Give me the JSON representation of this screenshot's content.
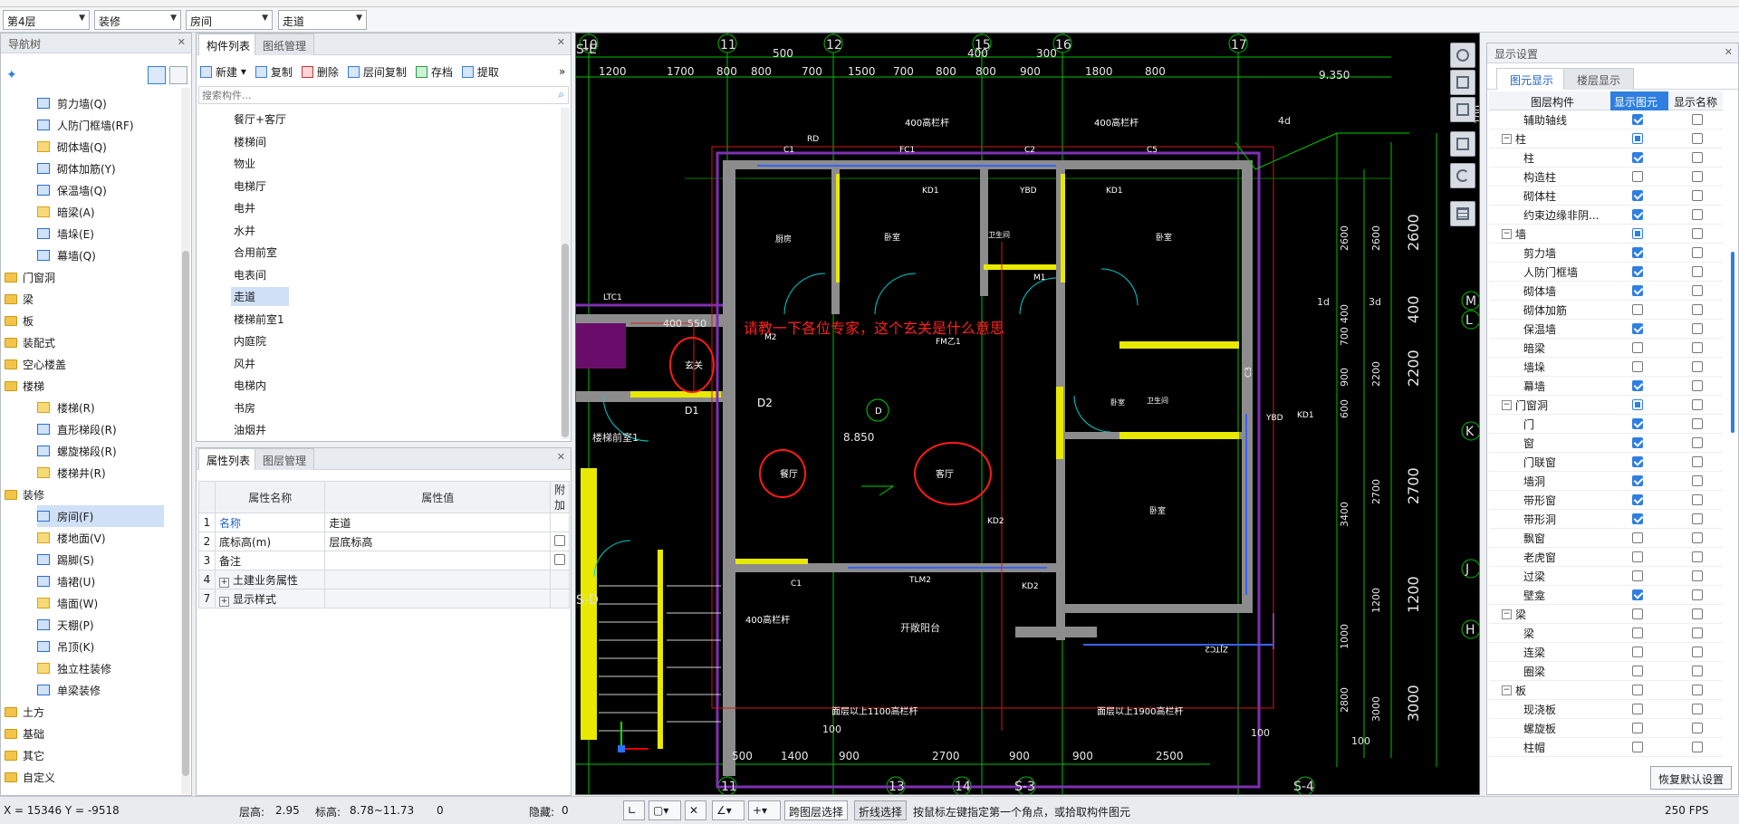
{
  "topbar": {
    "floor": "第4层",
    "category": "装修",
    "component": "房间",
    "sub": "走道"
  },
  "nav": {
    "title": "导航树",
    "items": [
      {
        "label": "剪力墙(Q)",
        "indent": 2
      },
      {
        "label": "人防门框墙(RF)",
        "indent": 2
      },
      {
        "label": "砌体墙(Q)",
        "indent": 2
      },
      {
        "label": "砌体加筋(Y)",
        "indent": 2
      },
      {
        "label": "保温墙(Q)",
        "indent": 2
      },
      {
        "label": "暗梁(A)",
        "indent": 2
      },
      {
        "label": "墙垛(E)",
        "indent": 2
      },
      {
        "label": "幕墙(Q)",
        "indent": 2
      },
      {
        "label": "门窗洞",
        "indent": 0
      },
      {
        "label": "梁",
        "indent": 0
      },
      {
        "label": "板",
        "indent": 0
      },
      {
        "label": "装配式",
        "indent": 0
      },
      {
        "label": "空心楼盖",
        "indent": 0
      },
      {
        "label": "楼梯",
        "indent": 0
      },
      {
        "label": "楼梯(R)",
        "indent": 2
      },
      {
        "label": "直形梯段(R)",
        "indent": 2
      },
      {
        "label": "螺旋梯段(R)",
        "indent": 2
      },
      {
        "label": "楼梯井(R)",
        "indent": 2
      },
      {
        "label": "装修",
        "indent": 0
      },
      {
        "label": "房间(F)",
        "indent": 2,
        "selected": true
      },
      {
        "label": "楼地面(V)",
        "indent": 2
      },
      {
        "label": "踢脚(S)",
        "indent": 2
      },
      {
        "label": "墙裙(U)",
        "indent": 2
      },
      {
        "label": "墙面(W)",
        "indent": 2
      },
      {
        "label": "天棚(P)",
        "indent": 2
      },
      {
        "label": "吊顶(K)",
        "indent": 2
      },
      {
        "label": "独立柱装修",
        "indent": 2
      },
      {
        "label": "单梁装修",
        "indent": 2
      },
      {
        "label": "土方",
        "indent": 0
      },
      {
        "label": "基础",
        "indent": 0
      },
      {
        "label": "其它",
        "indent": 0
      },
      {
        "label": "自定义",
        "indent": 0
      }
    ]
  },
  "complist": {
    "tabs": [
      "构件列表",
      "图纸管理"
    ],
    "toolbar": [
      "新建",
      "复制",
      "删除",
      "层间复制",
      "存档",
      "提取"
    ],
    "search_placeholder": "搜索构件...",
    "items": [
      "餐厅+客厅",
      "楼梯间",
      "物业",
      "电梯厅",
      "电井",
      "水井",
      "合用前室",
      "电表间",
      "走道",
      "楼梯前室1",
      "内庭院",
      "风井",
      "电梯内",
      "书房",
      "油烟井"
    ],
    "selected": "走道"
  },
  "props": {
    "tabs": [
      "属性列表",
      "图层管理"
    ],
    "headers": [
      "",
      "属性名称",
      "属性值",
      "附加"
    ],
    "rows": [
      {
        "num": "1",
        "name": "名称",
        "value": "走道",
        "extra": ""
      },
      {
        "num": "2",
        "name": "底标高(m)",
        "value": "层底标高",
        "extra": "cb"
      },
      {
        "num": "3",
        "name": "备注",
        "value": "",
        "extra": "cb"
      },
      {
        "num": "4",
        "name": "土建业务属性",
        "value": "",
        "extra": "",
        "expand": true
      },
      {
        "num": "7",
        "name": "显示样式",
        "value": "",
        "extra": "",
        "expand": true
      }
    ]
  },
  "cad": {
    "top_axes": [
      "10",
      "11",
      "12",
      "15",
      "16",
      "17"
    ],
    "top_dims": [
      "1200",
      "1700",
      "800",
      "800",
      "700",
      "1500",
      "700",
      "800",
      "800",
      "900",
      "1800",
      "800"
    ],
    "top_dims2": [
      "500",
      "400",
      "300"
    ],
    "bottom_dims": [
      "500",
      "1400",
      "900",
      "2700",
      "900",
      "900",
      "2500"
    ],
    "bottom_axes": [
      "11",
      "13",
      "14",
      "S-3",
      "S-4"
    ],
    "right_axes": [
      "M",
      "L",
      "K",
      "J",
      "H"
    ],
    "right_dims": [
      "2600",
      "400",
      "2200",
      "2700",
      "1200",
      "3000"
    ],
    "right_dims_small": [
      "2600",
      "2600",
      "400",
      "700",
      "900",
      "600",
      "2200",
      "3400",
      "2700",
      "1200",
      "2800",
      "3000",
      "100",
      "1000"
    ],
    "left_axes": [
      "S-E",
      "S-D"
    ],
    "elev": "9.350",
    "elev2": "8.850",
    "annotation": "请教一下各位专家，这个玄关是什么意思",
    "room_labels": [
      "玄关",
      "餐厅",
      "客厅",
      "厨房",
      "卧室",
      "卧室",
      "卫生间",
      "卧室",
      "卫生间",
      "卧室",
      "D1",
      "D2",
      "D",
      "M1",
      "M2",
      "KD1",
      "KD1",
      "KD1",
      "YBD",
      "YBD",
      "FC1",
      "C1",
      "C2",
      "C5",
      "C1",
      "RD",
      "LTC1",
      "TLM2",
      "KD2",
      "KD2",
      "FM乙1",
      "FM乙1",
      "C3",
      "ZJTC2"
    ],
    "rails": [
      "400高栏杆",
      "400高栏杆",
      "400高栏杆",
      "面层以上1100高栏杆",
      "面层以上1900高栏杆"
    ],
    "misc": [
      "400",
      "550",
      "100",
      "100",
      "100",
      "楼梯前室1",
      "开敞阳台",
      "4d",
      "3d",
      "1d"
    ]
  },
  "display": {
    "title": "显示设置",
    "tabs": [
      "图元显示",
      "楼层显示"
    ],
    "headers": [
      "图层构件",
      "显示图元",
      "显示名称"
    ],
    "rows": [
      {
        "label": "辅助轴线",
        "level": 2,
        "show": true,
        "name": false
      },
      {
        "label": "柱",
        "level": 1,
        "show": "part",
        "name": false
      },
      {
        "label": "柱",
        "level": 2,
        "show": true,
        "name": false
      },
      {
        "label": "构造柱",
        "level": 2,
        "show": false,
        "name": false
      },
      {
        "label": "砌体柱",
        "level": 2,
        "show": true,
        "name": false
      },
      {
        "label": "约束边缘非阴...",
        "level": 2,
        "show": true,
        "name": false
      },
      {
        "label": "墙",
        "level": 1,
        "show": "part",
        "name": false
      },
      {
        "label": "剪力墙",
        "level": 2,
        "show": true,
        "name": false
      },
      {
        "label": "人防门框墙",
        "level": 2,
        "show": true,
        "name": false
      },
      {
        "label": "砌体墙",
        "level": 2,
        "show": true,
        "name": false
      },
      {
        "label": "砌体加筋",
        "level": 2,
        "show": false,
        "name": false
      },
      {
        "label": "保温墙",
        "level": 2,
        "show": true,
        "name": false
      },
      {
        "label": "暗梁",
        "level": 2,
        "show": false,
        "name": false
      },
      {
        "label": "墙垛",
        "level": 2,
        "show": false,
        "name": false
      },
      {
        "label": "幕墙",
        "level": 2,
        "show": true,
        "name": false
      },
      {
        "label": "门窗洞",
        "level": 1,
        "show": "part",
        "name": false
      },
      {
        "label": "门",
        "level": 2,
        "show": true,
        "name": false
      },
      {
        "label": "窗",
        "level": 2,
        "show": true,
        "name": false
      },
      {
        "label": "门联窗",
        "level": 2,
        "show": true,
        "name": false
      },
      {
        "label": "墙洞",
        "level": 2,
        "show": true,
        "name": false
      },
      {
        "label": "带形窗",
        "level": 2,
        "show": true,
        "name": false
      },
      {
        "label": "带形洞",
        "level": 2,
        "show": true,
        "name": false
      },
      {
        "label": "飘窗",
        "level": 2,
        "show": false,
        "name": false
      },
      {
        "label": "老虎窗",
        "level": 2,
        "show": false,
        "name": false
      },
      {
        "label": "过梁",
        "level": 2,
        "show": false,
        "name": false
      },
      {
        "label": "壁龛",
        "level": 2,
        "show": true,
        "name": false
      },
      {
        "label": "梁",
        "level": 1,
        "show": false,
        "name": false
      },
      {
        "label": "梁",
        "level": 2,
        "show": false,
        "name": false
      },
      {
        "label": "连梁",
        "level": 2,
        "show": false,
        "name": false
      },
      {
        "label": "圈梁",
        "level": 2,
        "show": false,
        "name": false
      },
      {
        "label": "板",
        "level": 1,
        "show": false,
        "name": false
      },
      {
        "label": "现浇板",
        "level": 2,
        "show": false,
        "name": false
      },
      {
        "label": "螺旋板",
        "level": 2,
        "show": false,
        "name": false
      },
      {
        "label": "柱帽",
        "level": 2,
        "show": false,
        "name": false
      }
    ],
    "reset": "恢复默认设置"
  },
  "status": {
    "coords": "X = 15346 Y = -9518",
    "floor_h_label": "层高:",
    "floor_h": "2.95",
    "elev_label": "标高:",
    "elev": "8.78~11.73",
    "zero": "0",
    "hidden_label": "隐藏:",
    "hidden": "0",
    "btn_cross": "跨图层选择",
    "btn_polyline": "折线选择",
    "hint": "按鼠标左键指定第一个角点，或拾取构件图元",
    "fps": "250 FPS"
  }
}
